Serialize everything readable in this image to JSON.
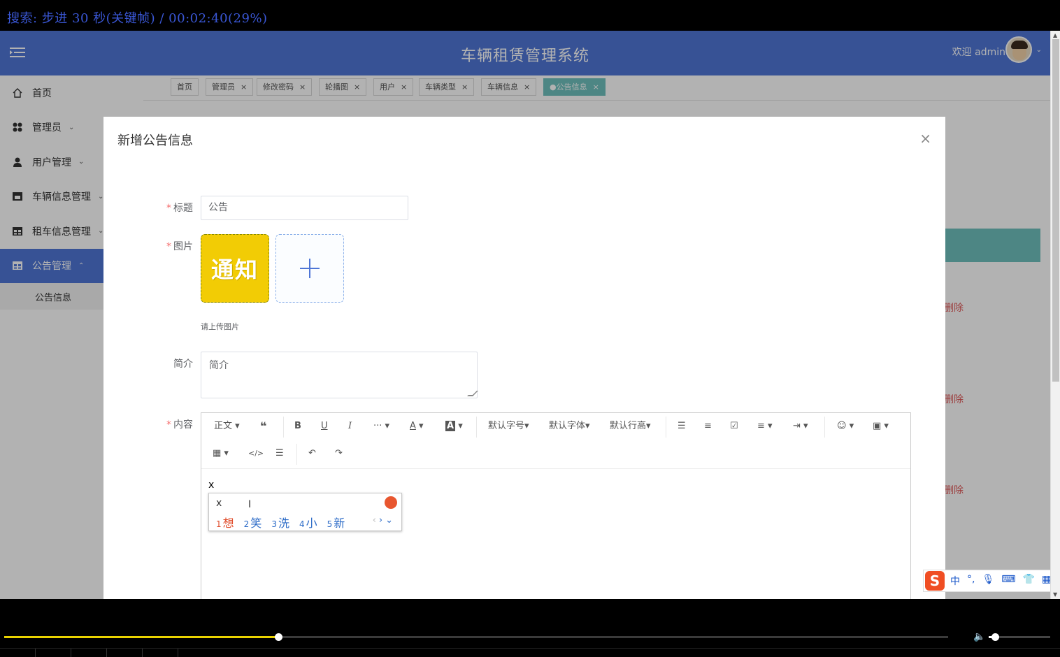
{
  "player": {
    "status_text": "搜索: 步进 30 秒(关键帧) / 00:02:40(29%)",
    "progress": 0.29,
    "volume": 0.1
  },
  "header": {
    "menu_icon": "menu-toggle-icon",
    "title": "车辆租赁管理系统",
    "welcome": "欢迎 admin",
    "accent_color": "#4f76d6"
  },
  "sidebar": {
    "items": [
      {
        "label": "首页",
        "icon": "home-icon",
        "has_caret": false
      },
      {
        "label": "管理员",
        "icon": "grid-icon",
        "has_caret": true
      },
      {
        "label": "用户管理",
        "icon": "user-icon",
        "has_caret": true
      },
      {
        "label": "车辆信息管理",
        "icon": "store-icon",
        "has_caret": true
      },
      {
        "label": "租车信息管理",
        "icon": "table-icon",
        "has_caret": true
      },
      {
        "label": "公告管理",
        "icon": "table-icon",
        "has_caret": true,
        "expanded": true
      }
    ],
    "sub_item": "公告信息"
  },
  "tabs": [
    {
      "label": "首页",
      "closable": false
    },
    {
      "label": "管理员",
      "closable": true
    },
    {
      "label": "修改密码",
      "closable": true
    },
    {
      "label": "轮播图",
      "closable": true
    },
    {
      "label": "用户",
      "closable": true
    },
    {
      "label": "车辆类型",
      "closable": true
    },
    {
      "label": "车辆信息",
      "closable": true
    },
    {
      "label": "●公告信息",
      "closable": true,
      "active": true
    }
  ],
  "background": {
    "delete_link": "删除"
  },
  "modal": {
    "title": "新增公告信息",
    "close_symbol": "×",
    "fields": {
      "title_label": "标题",
      "title_value": "公告",
      "image_label": "图片",
      "image_text": "通知",
      "upload_tip": "请上传图片",
      "summary_label": "简介",
      "summary_value": "简介",
      "content_label": "内容",
      "required_mark": "*"
    },
    "editor": {
      "toolbar": {
        "paragraph": "正文",
        "font_size": "默认字号",
        "font_family": "默认字体",
        "line_height": "默认行高"
      },
      "content_text": "x"
    }
  },
  "ime": {
    "typed": "x",
    "candidates": [
      {
        "n": "1",
        "text": "想"
      },
      {
        "n": "2",
        "text": "笑"
      },
      {
        "n": "3",
        "text": "洗"
      },
      {
        "n": "4",
        "text": "小"
      },
      {
        "n": "5",
        "text": "新"
      }
    ]
  },
  "sogou": {
    "logo": "S",
    "lang": "中",
    "punct": "°,"
  }
}
